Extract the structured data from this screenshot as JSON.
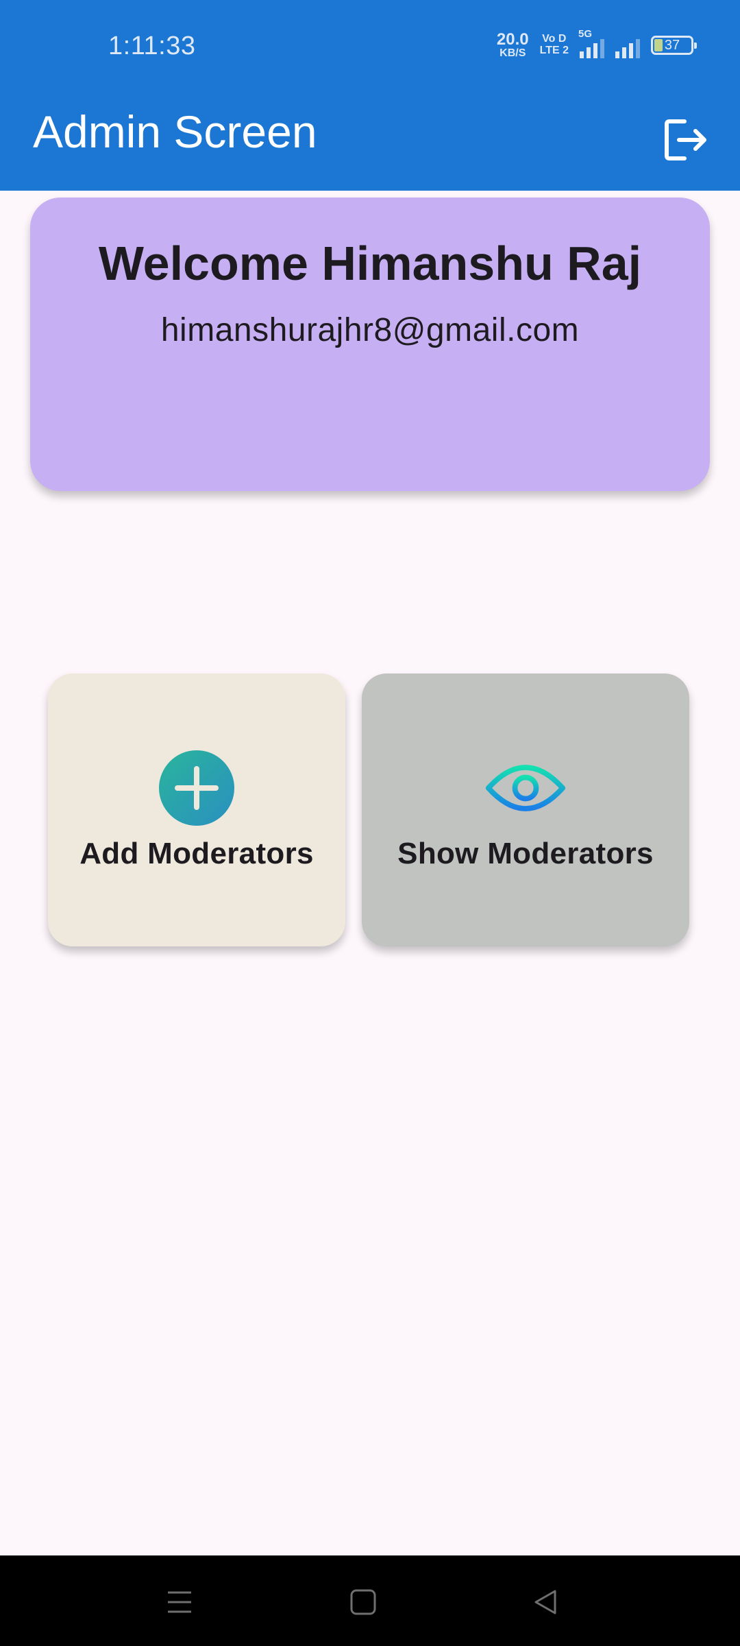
{
  "status_bar": {
    "time": "1:11:33",
    "net_speed_value": "20.0",
    "net_speed_unit": "KB/S",
    "volte_top": "Vo D",
    "volte_bottom": "LTE 2",
    "signal_label": "5G",
    "battery": "37"
  },
  "app_bar": {
    "title": "Admin Screen",
    "logout_icon": "logout-icon"
  },
  "welcome": {
    "title": "Welcome Himanshu Raj",
    "email": "himanshurajhr8@gmail.com"
  },
  "actions": {
    "add": {
      "label": "Add Moderators",
      "icon": "add-circle-icon"
    },
    "show": {
      "label": "Show Moderators",
      "icon": "eye-icon"
    }
  },
  "nav": {
    "recents_icon": "menu-icon",
    "home_icon": "home-square-icon",
    "back_icon": "back-triangle-icon"
  },
  "colors": {
    "app_bar": "#1b77d3",
    "welcome_card": "#c6aff2",
    "add_tile": "#eee9dc",
    "show_tile": "#c0c3c0",
    "background": "#fdf7fc",
    "icon_gradient_start": "#14e0b0",
    "icon_gradient_end": "#1a7fe8"
  }
}
